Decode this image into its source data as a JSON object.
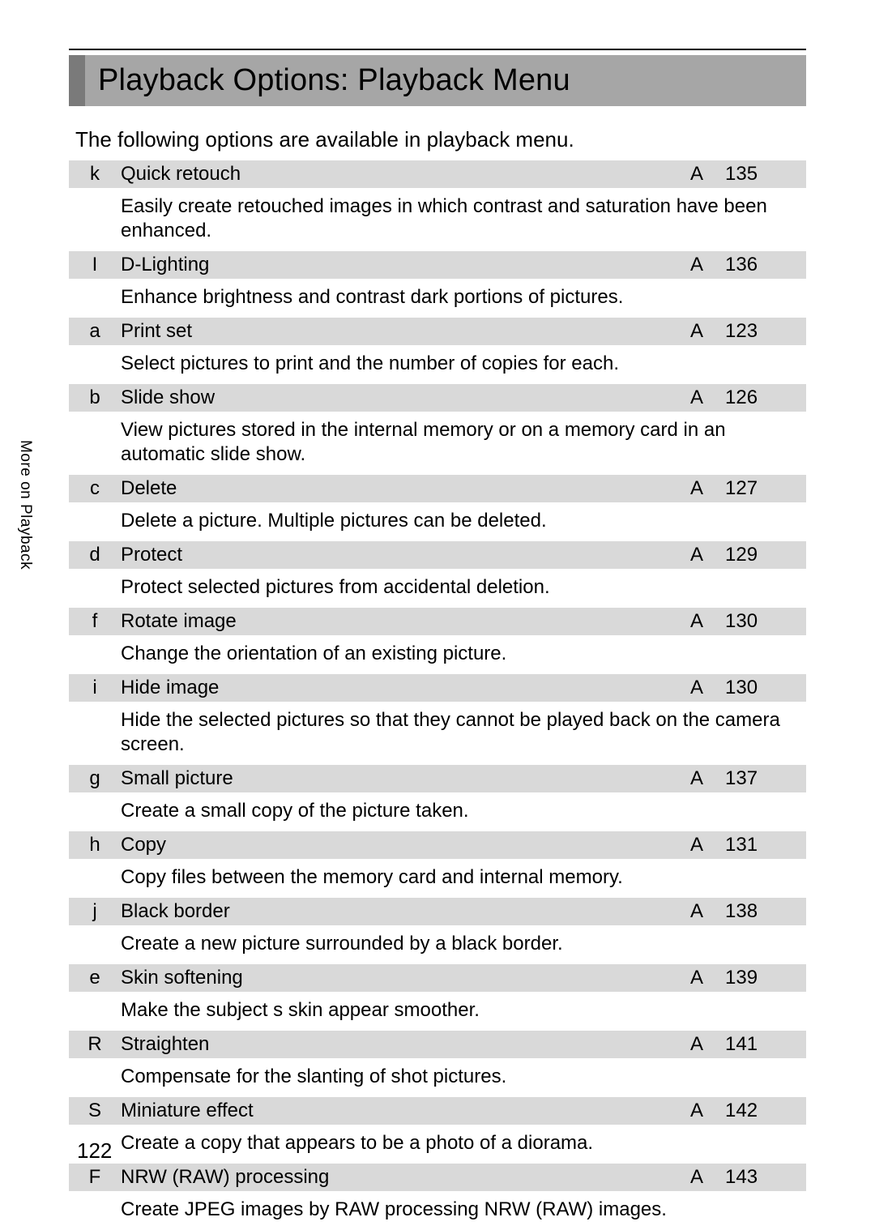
{
  "title": "Playback Options: Playback Menu",
  "intro": "The following options are available in playback menu.",
  "side_tab": "More on Playback",
  "page_number": "122",
  "ref_letter": "A",
  "items": [
    {
      "icon": "k",
      "name": "Quick retouch",
      "page": "135",
      "desc": "Easily create retouched images in which contrast and saturation have been enhanced."
    },
    {
      "icon": "I",
      "name": "D-Lighting",
      "page": "136",
      "desc": "Enhance brightness and contrast dark portions of pictures."
    },
    {
      "icon": "a",
      "name": "Print set",
      "page": "123",
      "desc": "Select pictures to print and the number of copies for each."
    },
    {
      "icon": "b",
      "name": "Slide show",
      "page": "126",
      "desc": "View pictures stored in the internal memory or on a memory card in an automatic slide show."
    },
    {
      "icon": "c",
      "name": "Delete",
      "page": "127",
      "desc": "Delete a picture. Multiple pictures can be deleted."
    },
    {
      "icon": "d",
      "name": "Protect",
      "page": "129",
      "desc": "Protect selected pictures from accidental deletion."
    },
    {
      "icon": "f",
      "name": "Rotate image",
      "page": "130",
      "desc": "Change the orientation of an existing picture."
    },
    {
      "icon": "i",
      "name": "Hide image",
      "page": "130",
      "desc": "Hide the selected pictures so that they cannot be played back on the camera screen."
    },
    {
      "icon": "g",
      "name": "Small picture",
      "page": "137",
      "desc": "Create a small copy of the picture taken."
    },
    {
      "icon": "h",
      "name": "Copy",
      "page": "131",
      "desc": "Copy files between the memory card and internal memory."
    },
    {
      "icon": "j",
      "name": "Black border",
      "page": "138",
      "desc": "Create a new picture surrounded by a black border."
    },
    {
      "icon": "e",
      "name": "Skin softening",
      "page": "139",
      "desc": "Make the subject s skin appear smoother."
    },
    {
      "icon": "R",
      "name": "Straighten",
      "page": "141",
      "desc": "Compensate for the slanting of shot pictures."
    },
    {
      "icon": "S",
      "name": "Miniature effect",
      "page": "142",
      "desc": "Create a copy that appears to be a photo of a diorama."
    },
    {
      "icon": "F",
      "name": "NRW (RAW) processing",
      "page": "143",
      "desc": "Create JPEG images by RAW processing NRW (RAW) images."
    }
  ]
}
